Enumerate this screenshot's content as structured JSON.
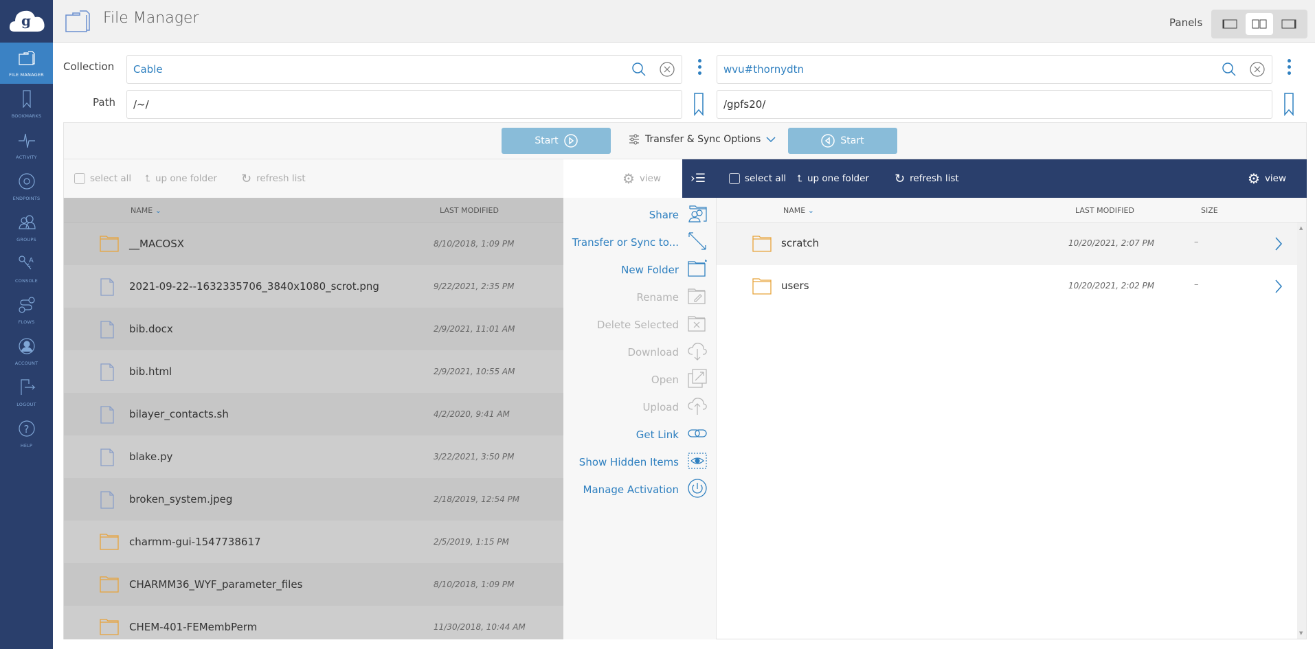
{
  "app": {
    "title": "File Manager"
  },
  "sidebar": {
    "items": [
      {
        "label": "FILE MANAGER",
        "icon": "folder-icon",
        "active": true
      },
      {
        "label": "BOOKMARKS",
        "icon": "bookmark-icon"
      },
      {
        "label": "ACTIVITY",
        "icon": "activity-icon"
      },
      {
        "label": "ENDPOINTS",
        "icon": "endpoint-icon"
      },
      {
        "label": "GROUPS",
        "icon": "groups-icon"
      },
      {
        "label": "CONSOLE",
        "icon": "console-icon"
      },
      {
        "label": "FLOWS",
        "icon": "flows-icon"
      },
      {
        "label": "ACCOUNT",
        "icon": "account-icon"
      },
      {
        "label": "LOGOUT",
        "icon": "logout-icon"
      },
      {
        "label": "HELP",
        "icon": "help-icon"
      }
    ]
  },
  "header": {
    "panels_label": "Panels",
    "panel_modes": [
      "single-left",
      "dual",
      "single-right"
    ],
    "selected_mode": "dual"
  },
  "labels": {
    "collection": "Collection",
    "path": "Path"
  },
  "left": {
    "collection": "Cable",
    "path": "/~/",
    "toolbar": {
      "select_all": "select all",
      "up_one_folder": "up one folder",
      "refresh_list": "refresh list",
      "view": "view"
    },
    "columns": {
      "name": "NAME",
      "last_modified": "LAST MODIFIED"
    },
    "files": [
      {
        "name": "__MACOSX",
        "type": "folder",
        "modified": "8/10/2018, 1:09 PM"
      },
      {
        "name": "2021-09-22--1632335706_3840x1080_scrot.png",
        "type": "file",
        "modified": "9/22/2021, 2:35 PM"
      },
      {
        "name": "bib.docx",
        "type": "file",
        "modified": "2/9/2021, 11:01 AM"
      },
      {
        "name": "bib.html",
        "type": "file",
        "modified": "2/9/2021, 10:55 AM"
      },
      {
        "name": "bilayer_contacts.sh",
        "type": "file",
        "modified": "4/2/2020, 9:41 AM"
      },
      {
        "name": "blake.py",
        "type": "file",
        "modified": "3/22/2021, 3:50 PM"
      },
      {
        "name": "broken_system.jpeg",
        "type": "file",
        "modified": "2/18/2019, 12:54 PM"
      },
      {
        "name": "charmm-gui-1547738617",
        "type": "folder",
        "modified": "2/5/2019, 1:15 PM"
      },
      {
        "name": "CHARMM36_WYF_parameter_files",
        "type": "folder",
        "modified": "8/10/2018, 1:09 PM"
      },
      {
        "name": "CHEM-401-FEMembPerm",
        "type": "folder",
        "modified": "11/30/2018, 10:44 AM"
      }
    ]
  },
  "right": {
    "collection": "wvu#thornydtn",
    "path": "/gpfs20/",
    "toolbar": {
      "select_all": "select all",
      "up_one_folder": "up one folder",
      "refresh_list": "refresh list",
      "view": "view"
    },
    "columns": {
      "name": "NAME",
      "last_modified": "LAST MODIFIED",
      "size": "SIZE"
    },
    "files": [
      {
        "name": "scratch",
        "type": "folder",
        "modified": "10/20/2021, 2:07 PM",
        "size": "–"
      },
      {
        "name": "users",
        "type": "folder",
        "modified": "10/20/2021, 2:02 PM",
        "size": "–"
      }
    ]
  },
  "transfer": {
    "start_label": "Start",
    "options_label": "Transfer & Sync Options"
  },
  "actions": [
    {
      "label": "Share",
      "enabled": true,
      "icon": "share-icon"
    },
    {
      "label": "Transfer or Sync to...",
      "enabled": true,
      "icon": "transfer-icon"
    },
    {
      "label": "New Folder",
      "enabled": true,
      "icon": "new-folder-icon"
    },
    {
      "label": "Rename",
      "enabled": false,
      "icon": "rename-icon"
    },
    {
      "label": "Delete Selected",
      "enabled": false,
      "icon": "delete-icon"
    },
    {
      "label": "Download",
      "enabled": false,
      "icon": "download-icon"
    },
    {
      "label": "Open",
      "enabled": false,
      "icon": "open-icon"
    },
    {
      "label": "Upload",
      "enabled": false,
      "icon": "upload-icon"
    },
    {
      "label": "Get Link",
      "enabled": true,
      "icon": "link-icon"
    },
    {
      "label": "Show Hidden Items",
      "enabled": true,
      "icon": "eye-icon"
    },
    {
      "label": "Manage Activation",
      "enabled": true,
      "icon": "power-icon"
    }
  ],
  "colors": {
    "sidebar": "#2a3f6c",
    "active": "#3b82c4",
    "link": "#2f80c0",
    "start": "#89bcd9",
    "folder": "#e8a33a"
  }
}
